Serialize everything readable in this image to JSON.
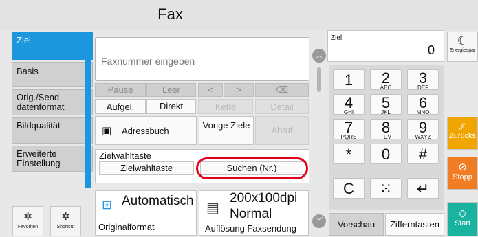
{
  "title": "Fax",
  "tabs": [
    {
      "label": "Ziel",
      "active": true
    },
    {
      "label": "Basis"
    },
    {
      "label": "Orig./Send-datenformat"
    },
    {
      "label": "Bildqualität"
    },
    {
      "label": "Erweiterte Einstellung"
    }
  ],
  "shortcuts": {
    "favorites": "Favoriten",
    "shortcut": "Shortcut"
  },
  "input": {
    "placeholder": "Faxnummer eingeben"
  },
  "edit_row": {
    "pause": "Pause",
    "leer": "Leer",
    "left": "<",
    "right": ">",
    "backspace": "⌫"
  },
  "mode_row": {
    "aufgel": "Aufgel.",
    "direkt": "Direkt",
    "kette": "Kette",
    "detail": "Detail"
  },
  "addr_row": {
    "adressbuch": "Adressbuch",
    "vorige": "Vorige Ziele",
    "abruf": "Abruf"
  },
  "zielwahl": {
    "label": "Zielwahltaste",
    "button": "Zielwahltaste",
    "search": "Suchen (Nr.)"
  },
  "original": {
    "value": "Automatisch",
    "label": "Originalformat"
  },
  "resolution": {
    "value1": "200x100dpi",
    "value2": "Normal",
    "label": "Auflösung Faxsendung"
  },
  "ziel": {
    "label": "Ziel",
    "count": "0"
  },
  "keypad": [
    {
      "n": "1",
      "l": ""
    },
    {
      "n": "2",
      "l": "ABC"
    },
    {
      "n": "3",
      "l": "DEF"
    },
    {
      "n": "4",
      "l": "GHI"
    },
    {
      "n": "5",
      "l": "JKL"
    },
    {
      "n": "6",
      "l": "MNO"
    },
    {
      "n": "7",
      "l": "PQRS"
    },
    {
      "n": "8",
      "l": "TUV"
    },
    {
      "n": "9",
      "l": "WXYZ"
    },
    {
      "n": "*",
      "l": ""
    },
    {
      "n": "0",
      "l": ""
    },
    {
      "n": "#",
      "l": ""
    },
    {
      "n": "C",
      "l": ""
    },
    {
      "n": "⁙",
      "l": ""
    },
    {
      "n": "↵",
      "l": ""
    }
  ],
  "bottom_right": {
    "vorschau": "Vorschau",
    "zifferntasten": "Zifferntasten"
  },
  "side": {
    "energie": "Energiespar",
    "zurueck": "Zurücks",
    "stopp": "Stopp",
    "start": "Start"
  },
  "colors": {
    "accent": "#1c96dc",
    "stop": "#f07d24",
    "start": "#1ab3a0",
    "back": "#f0a500",
    "highlight": "#e3001b"
  }
}
